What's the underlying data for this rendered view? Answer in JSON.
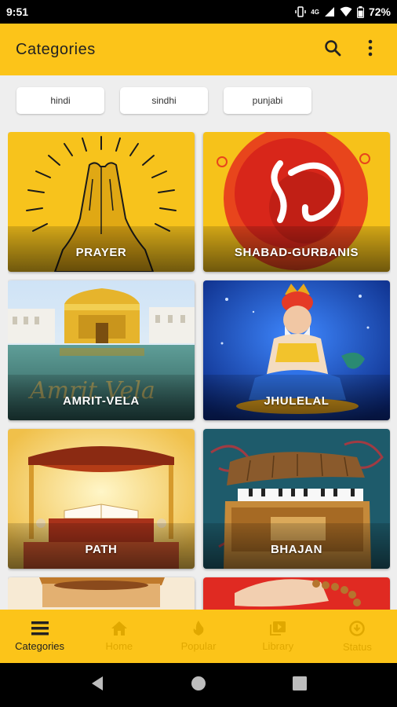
{
  "status_bar": {
    "time": "9:51",
    "battery": "72%",
    "network": "4G"
  },
  "app_bar": {
    "title": "Categories",
    "search_icon": "search-icon",
    "more_icon": "more-vert-icon"
  },
  "languages": [
    {
      "label": "hindi"
    },
    {
      "label": "sindhi"
    },
    {
      "label": "punjabi"
    }
  ],
  "categories": [
    {
      "label": "PRAYER"
    },
    {
      "label": "SHABAD-GURBANIS"
    },
    {
      "label": "AMRIT-VELA"
    },
    {
      "label": "JHULELAL"
    },
    {
      "label": "PATH"
    },
    {
      "label": "BHAJAN"
    },
    {
      "label": ""
    },
    {
      "label": ""
    }
  ],
  "bottom_nav": [
    {
      "label": "Categories",
      "icon": "menu-icon",
      "active": true
    },
    {
      "label": "Home",
      "icon": "home-icon",
      "active": false
    },
    {
      "label": "Popular",
      "icon": "flame-icon",
      "active": false
    },
    {
      "label": "Library",
      "icon": "library-icon",
      "active": false
    },
    {
      "label": "Status",
      "icon": "download-icon",
      "active": false
    }
  ],
  "colors": {
    "accent": "#fcc419",
    "inactive_nav": "#e0a800"
  }
}
